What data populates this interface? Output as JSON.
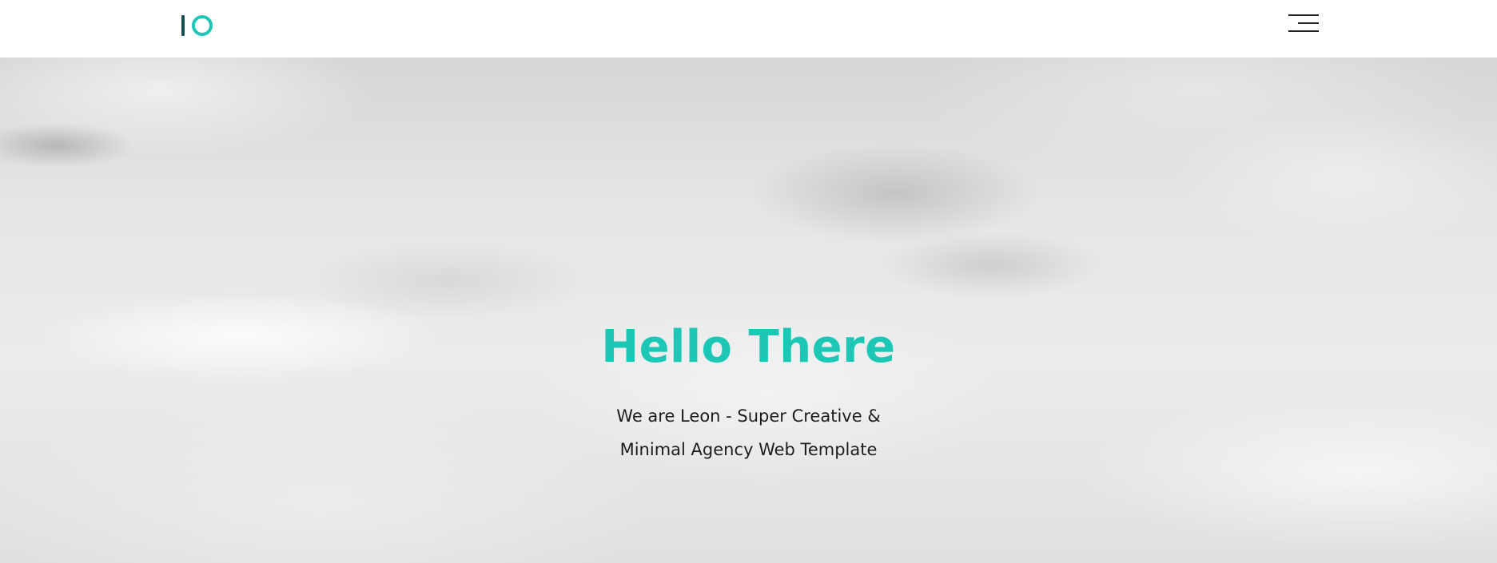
{
  "header": {
    "logo_icon": "io-logo-icon",
    "menu_icon": "hamburger-menu-icon"
  },
  "hero": {
    "title": "Hello There",
    "subtitle_line1": "We are Leon - Super Creative &",
    "subtitle_line2": "Minimal Agency Web Template",
    "background_image": "cloudy-sky-image"
  },
  "colors": {
    "accent": "#1cc8b5",
    "logo_dark": "#1b4b54",
    "text": "#1d1d1d",
    "header_bg": "#ffffff"
  }
}
